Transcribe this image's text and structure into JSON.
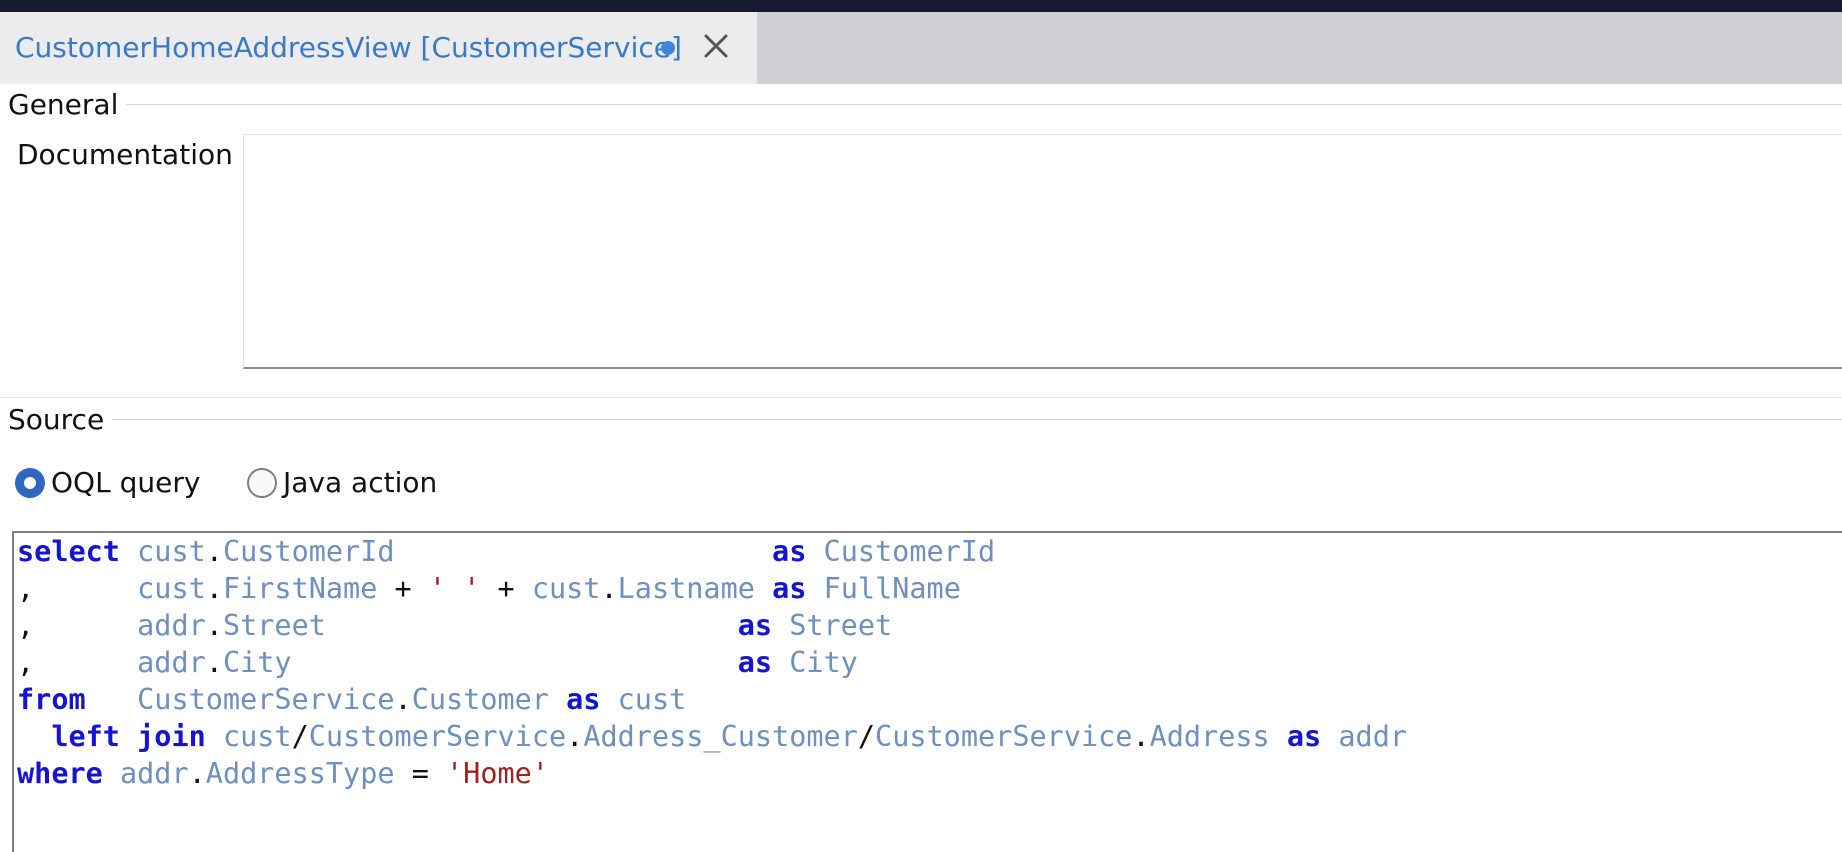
{
  "tab": {
    "title": "CustomerHomeAddressView [CustomerService]",
    "unsaved_indicator": "dot",
    "close_icon": "close-icon"
  },
  "sections": {
    "general": "General",
    "documentation_label": "Documentation",
    "documentation_value": "",
    "source": "Source"
  },
  "source_options": [
    {
      "label": "OQL query",
      "selected": true
    },
    {
      "label": "Java action",
      "selected": false
    }
  ],
  "code": {
    "line1": {
      "k1": "select",
      "s1": " ",
      "a": "cust",
      "d": ".",
      "b": "CustomerId",
      "pad": "                      ",
      "k2": "as",
      "s2": " ",
      "alias": "CustomerId"
    },
    "line2": {
      "c": ",",
      "ind": "      ",
      "a": "cust",
      "d1": ".",
      "b": "FirstName",
      "o1": " + ",
      "q": "' '",
      "o2": " + ",
      "e": "cust",
      "d2": ".",
      "f": "Lastname",
      "s1": " ",
      "k": "as",
      "s2": " ",
      "alias": "FullName"
    },
    "line3": {
      "c": ",",
      "ind": "      ",
      "a": "addr",
      "d": ".",
      "b": "Street",
      "pad": "                        ",
      "k": "as",
      "s2": " ",
      "alias": "Street"
    },
    "line4": {
      "c": ",",
      "ind": "      ",
      "a": "addr",
      "d": ".",
      "b": "City",
      "pad": "                          ",
      "k": "as",
      "s2": " ",
      "alias": "City"
    },
    "line5": {
      "k1": "from",
      "s1": "   ",
      "a": "CustomerService",
      "d": ".",
      "b": "Customer",
      "s2": " ",
      "k2": "as",
      "s3": " ",
      "alias": "cust"
    },
    "line6": {
      "ind": "  ",
      "k1": "left",
      "s1": " ",
      "k2": "join",
      "s2": " ",
      "a": "cust",
      "sl1": "/",
      "b": "CustomerService",
      "d1": ".",
      "c": "Address_Customer",
      "sl2": "/",
      "e": "CustomerService",
      "d2": ".",
      "f": "Address",
      "s3": " ",
      "k3": "as",
      "s4": " ",
      "alias": "addr"
    },
    "line7": {
      "k1": "where",
      "s1": " ",
      "a": "addr",
      "d": ".",
      "b": "AddressType",
      "o": " = ",
      "str": "'Home'"
    }
  },
  "colors": {
    "tab_title": "#3a79c8",
    "keyword": "#1414d2",
    "identifier": "#6f8fbe",
    "string": "#a51f1f",
    "radio_selected": "#2f67c0"
  }
}
